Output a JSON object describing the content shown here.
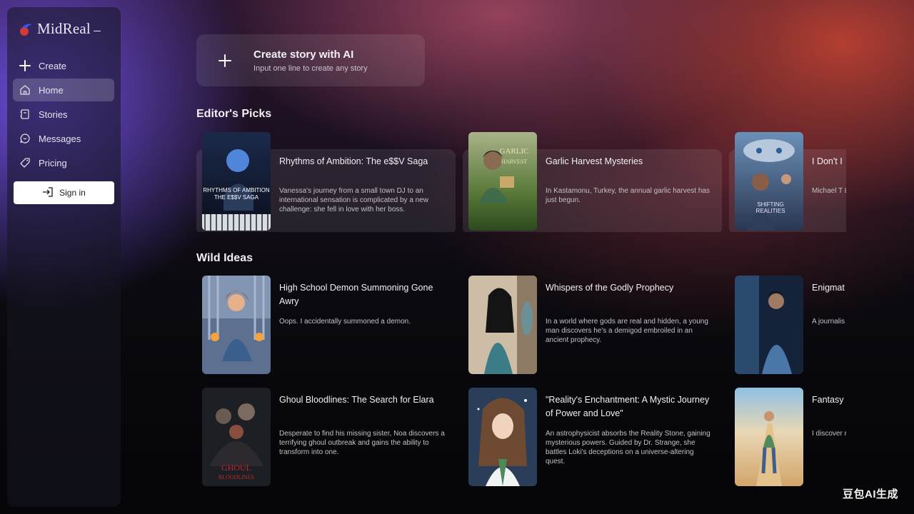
{
  "brand": {
    "logo_text": "MidReal",
    "accent": "#d23a3a"
  },
  "sidebar": {
    "items": [
      {
        "label": "Create",
        "icon": "plus-icon"
      },
      {
        "label": "Home",
        "icon": "home-icon",
        "active": true
      },
      {
        "label": "Stories",
        "icon": "book-icon"
      },
      {
        "label": "Messages",
        "icon": "chat-icon"
      },
      {
        "label": "Pricing",
        "icon": "tag-icon"
      }
    ],
    "signin_label": "Sign in"
  },
  "create_story": {
    "title": "Create story with AI",
    "subtitle": "Input one line to create any story"
  },
  "editors_picks": {
    "title": "Editor's Picks",
    "items": [
      {
        "title": "Rhythms of Ambition: The e$$V Saga",
        "desc": "Vanessa's journey from a small town DJ to an international sensation is complicated by a new challenge: she fell in love with her boss.",
        "cover_text": "RHYTHMS OF AMBITION THE E$$V SAGA"
      },
      {
        "title": "Garlic Harvest Mysteries",
        "desc": "In Kastamonu, Turkey, the annual garlic harvest has just begun.",
        "cover_text": "GARLIC HARVEST"
      },
      {
        "title": "I Don't I",
        "desc": "Michael T Long to h place fille new self.",
        "cover_text": "SHIFTING REALITIES"
      }
    ]
  },
  "wild_ideas": {
    "title": "Wild Ideas",
    "rows": [
      [
        {
          "title": "High School Demon Summoning Gone Awry",
          "desc": "Oops. I accidentally summoned a demon."
        },
        {
          "title": "Whispers of the Godly Prophecy",
          "desc": "In a world where gods are real and hidden, a young man discovers he's a demigod embroiled in an ancient prophecy."
        },
        {
          "title": "Enigmat Dilemms",
          "desc": "A journalis in Kolkata the enigm"
        }
      ],
      [
        {
          "title": "Ghoul Bloodlines: The Search for Elara",
          "desc": "Desperate to find his missing sister, Noa discovers a terrifying ghoul outbreak and gains the ability to transform into one.",
          "cover_text": "GHOUL BLOODLINES"
        },
        {
          "title": "\"Reality's Enchantment: A Mystic Journey of Power and Love\"",
          "desc": "An astrophysicist absorbs the Reality Stone, gaining mysterious powers. Guided by Dr. Strange, she battles Loki's deceptions on a universe-altering quest."
        },
        {
          "title": "Fantasy Reality",
          "desc": "I discover region."
        }
      ]
    ]
  },
  "watermark": "豆包AI生成"
}
